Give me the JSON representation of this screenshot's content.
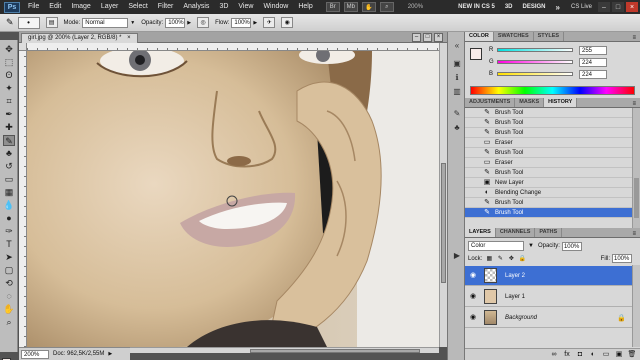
{
  "menubar": {
    "logo": "Ps",
    "items": [
      "File",
      "Edit",
      "Image",
      "Layer",
      "Select",
      "Filter",
      "Analysis",
      "3D",
      "View",
      "Window",
      "Help"
    ],
    "zoom": "200%",
    "workspaces": [
      "NEW IN CS 5",
      "3D",
      "DESIGN"
    ],
    "more": "»",
    "cslive": "CS Live"
  },
  "options": {
    "mode_label": "Mode:",
    "mode_value": "Normal",
    "opacity_label": "Opacity:",
    "opacity_value": "100%",
    "flow_label": "Flow:",
    "flow_value": "100%"
  },
  "document": {
    "tab_title": "girl.jpg @ 200% (Layer 2, RGB/8) *",
    "zoom": "200%",
    "doc_info": "Doc: 962,5K/2,55M"
  },
  "color_panel": {
    "tabs": [
      "COLOR",
      "SWATCHES",
      "STYLES"
    ],
    "channels": [
      {
        "name": "R",
        "value": "255",
        "gradient": "linear-gradient(90deg,#00e0e0,#fff)"
      },
      {
        "name": "G",
        "value": "224",
        "gradient": "linear-gradient(90deg,#ff00e0,#fff)"
      },
      {
        "name": "B",
        "value": "224",
        "gradient": "linear-gradient(90deg,#ffe000,#fff)"
      }
    ]
  },
  "history_panel": {
    "tabs": [
      "ADJUSTMENTS",
      "MASKS",
      "HISTORY"
    ],
    "items": [
      {
        "label": "Brush Tool",
        "icon": "brush-icon"
      },
      {
        "label": "Brush Tool",
        "icon": "brush-icon"
      },
      {
        "label": "Brush Tool",
        "icon": "brush-icon"
      },
      {
        "label": "Eraser",
        "icon": "eraser-icon"
      },
      {
        "label": "Brush Tool",
        "icon": "brush-icon"
      },
      {
        "label": "Eraser",
        "icon": "eraser-icon"
      },
      {
        "label": "Brush Tool",
        "icon": "brush-icon"
      },
      {
        "label": "New Layer",
        "icon": "new-layer-icon"
      },
      {
        "label": "Blending Change",
        "icon": "blend-icon"
      },
      {
        "label": "Brush Tool",
        "icon": "brush-icon"
      },
      {
        "label": "Brush Tool",
        "icon": "brush-icon"
      }
    ],
    "active_index": 10
  },
  "layers_panel": {
    "tabs": [
      "LAYERS",
      "CHANNELS",
      "PATHS"
    ],
    "blend_mode": "Color",
    "opacity_label": "Opacity:",
    "opacity_value": "100%",
    "lock_label": "Lock:",
    "fill_label": "Fill:",
    "fill_value": "100%",
    "layers": [
      {
        "name": "Layer 2",
        "thumb": "check",
        "active": true
      },
      {
        "name": "Layer 1",
        "thumb": "l1",
        "active": false
      },
      {
        "name": "Background",
        "thumb": "bg",
        "active": false,
        "locked": true
      }
    ]
  },
  "colors": {
    "selection": "#3d6fd3",
    "fg_swatch": "#f8ecea"
  }
}
